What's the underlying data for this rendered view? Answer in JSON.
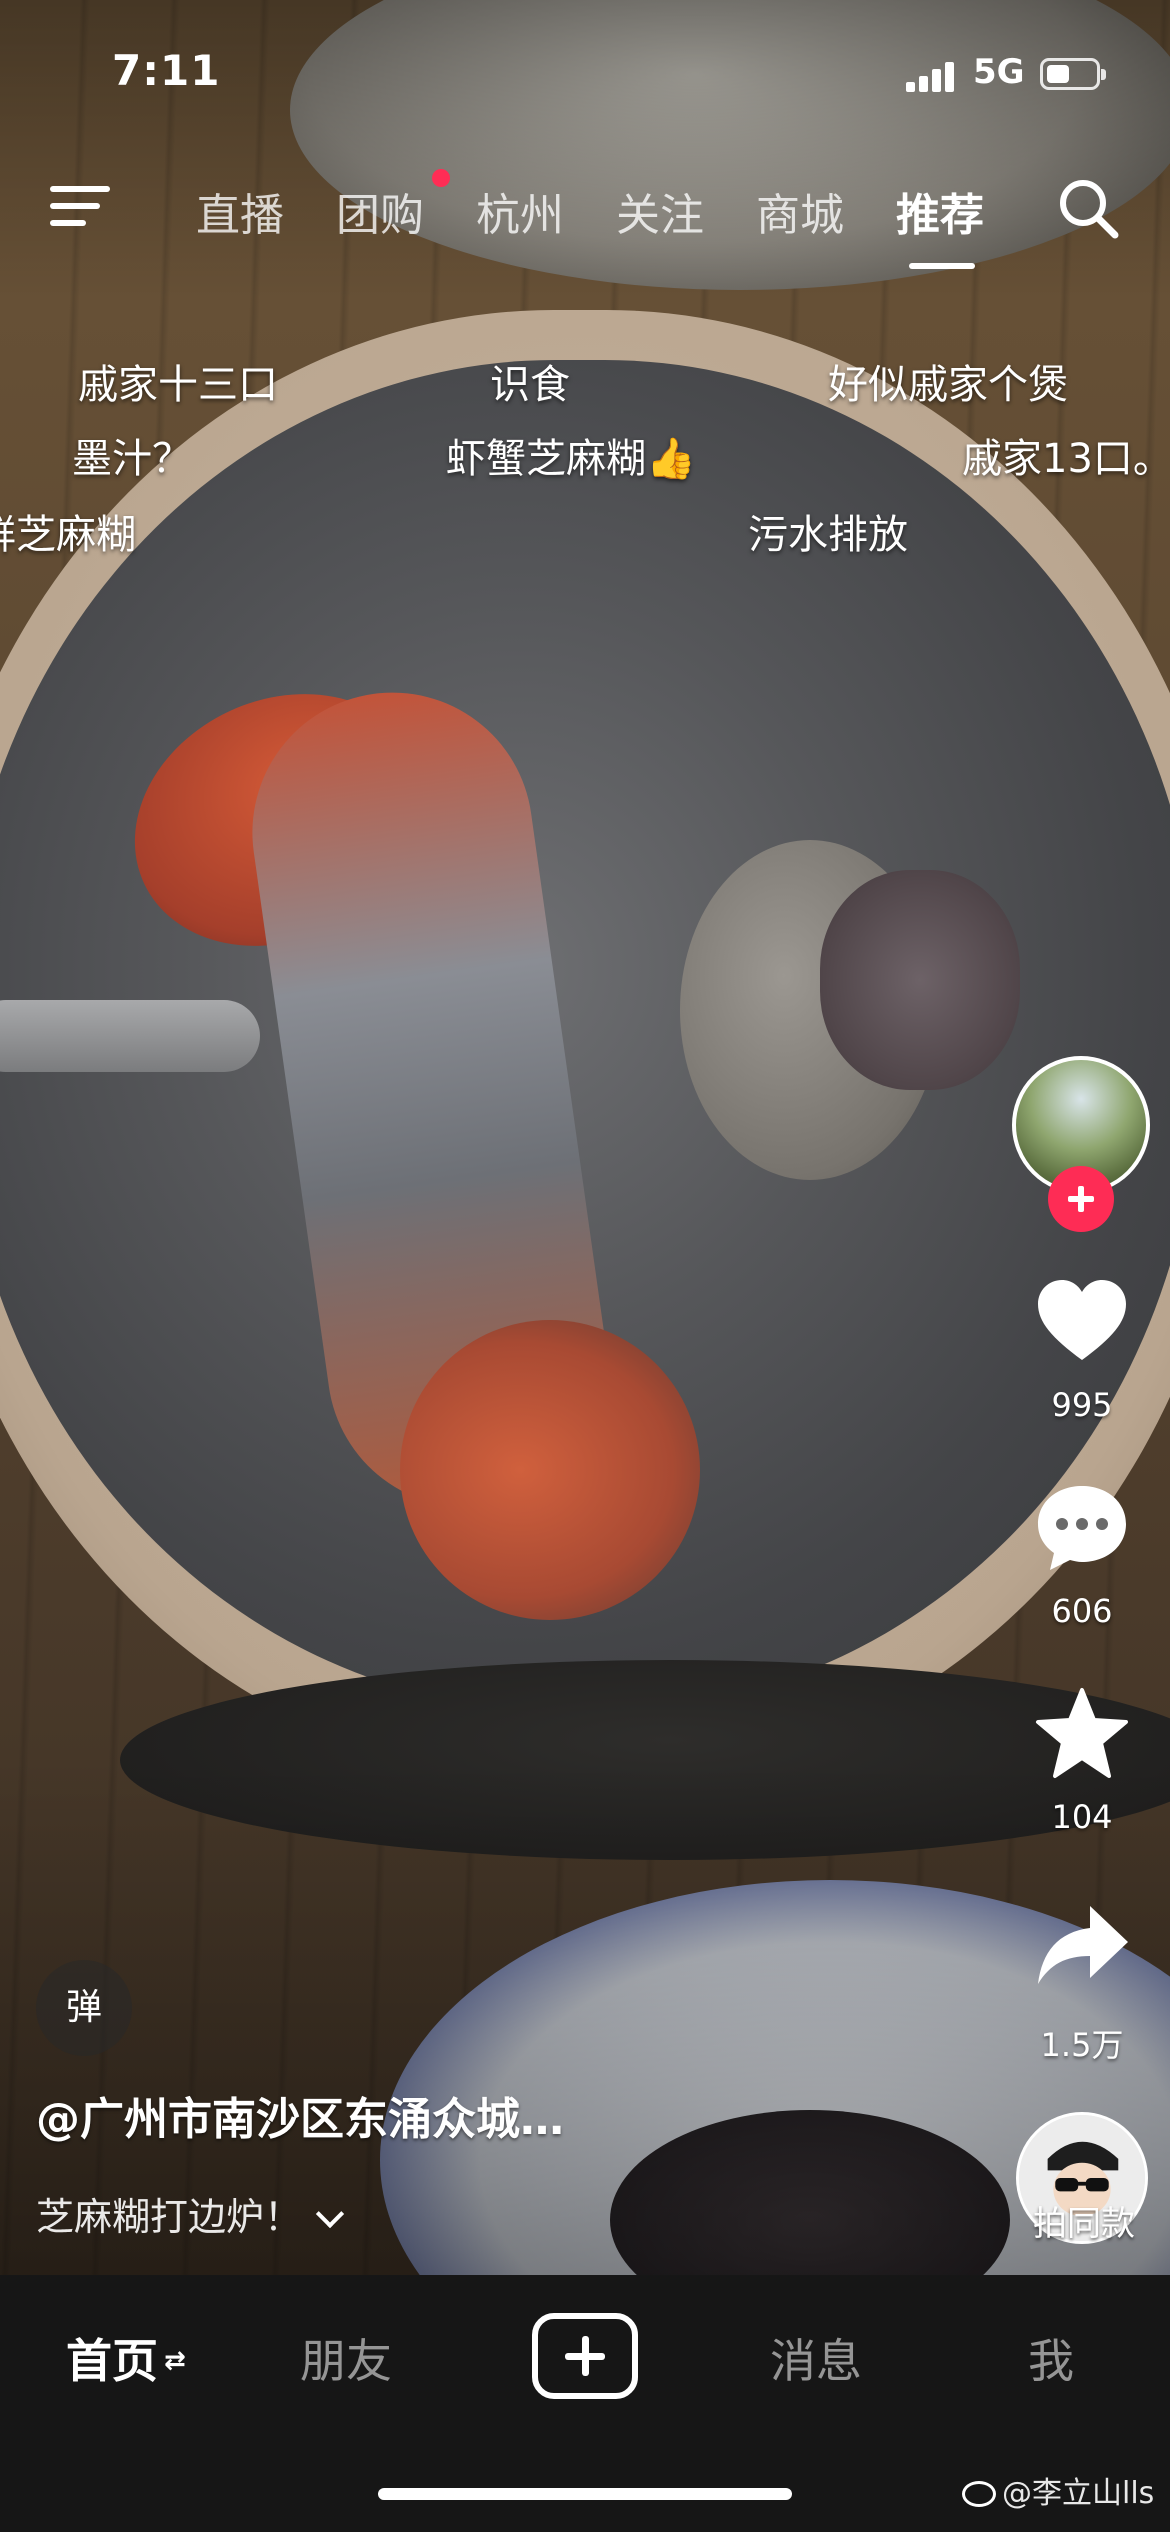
{
  "status_bar": {
    "time": "7:11",
    "network": "5G"
  },
  "top_nav": {
    "tabs": [
      {
        "label": "直播"
      },
      {
        "label": "团购"
      },
      {
        "label": "杭州"
      },
      {
        "label": "关注"
      },
      {
        "label": "商城"
      },
      {
        "label": "推荐",
        "active": true
      }
    ]
  },
  "danmaku": [
    "戚家十三口",
    "识食",
    "好似戚家个煲",
    "墨汁？",
    "虾蟹芝麻糊👍",
    "戚家13口。",
    "鲜芝麻糊",
    "污水排放"
  ],
  "sidebar": {
    "like_count": "995",
    "comment_count": "606",
    "favorite_count": "104",
    "share_count": "1.5万",
    "music_label": "拍同款"
  },
  "caption": {
    "danmaku_toggle": "弹",
    "author": "@广州市南沙区东涌众城…",
    "description": "芝麻糊打边炉！"
  },
  "bottom_nav": {
    "home": "首页",
    "friends": "朋友",
    "messages": "消息",
    "me": "我"
  },
  "watermark": "@李立山lls",
  "colors": {
    "accent": "#fe2c55",
    "bar_bg": "#161616"
  }
}
